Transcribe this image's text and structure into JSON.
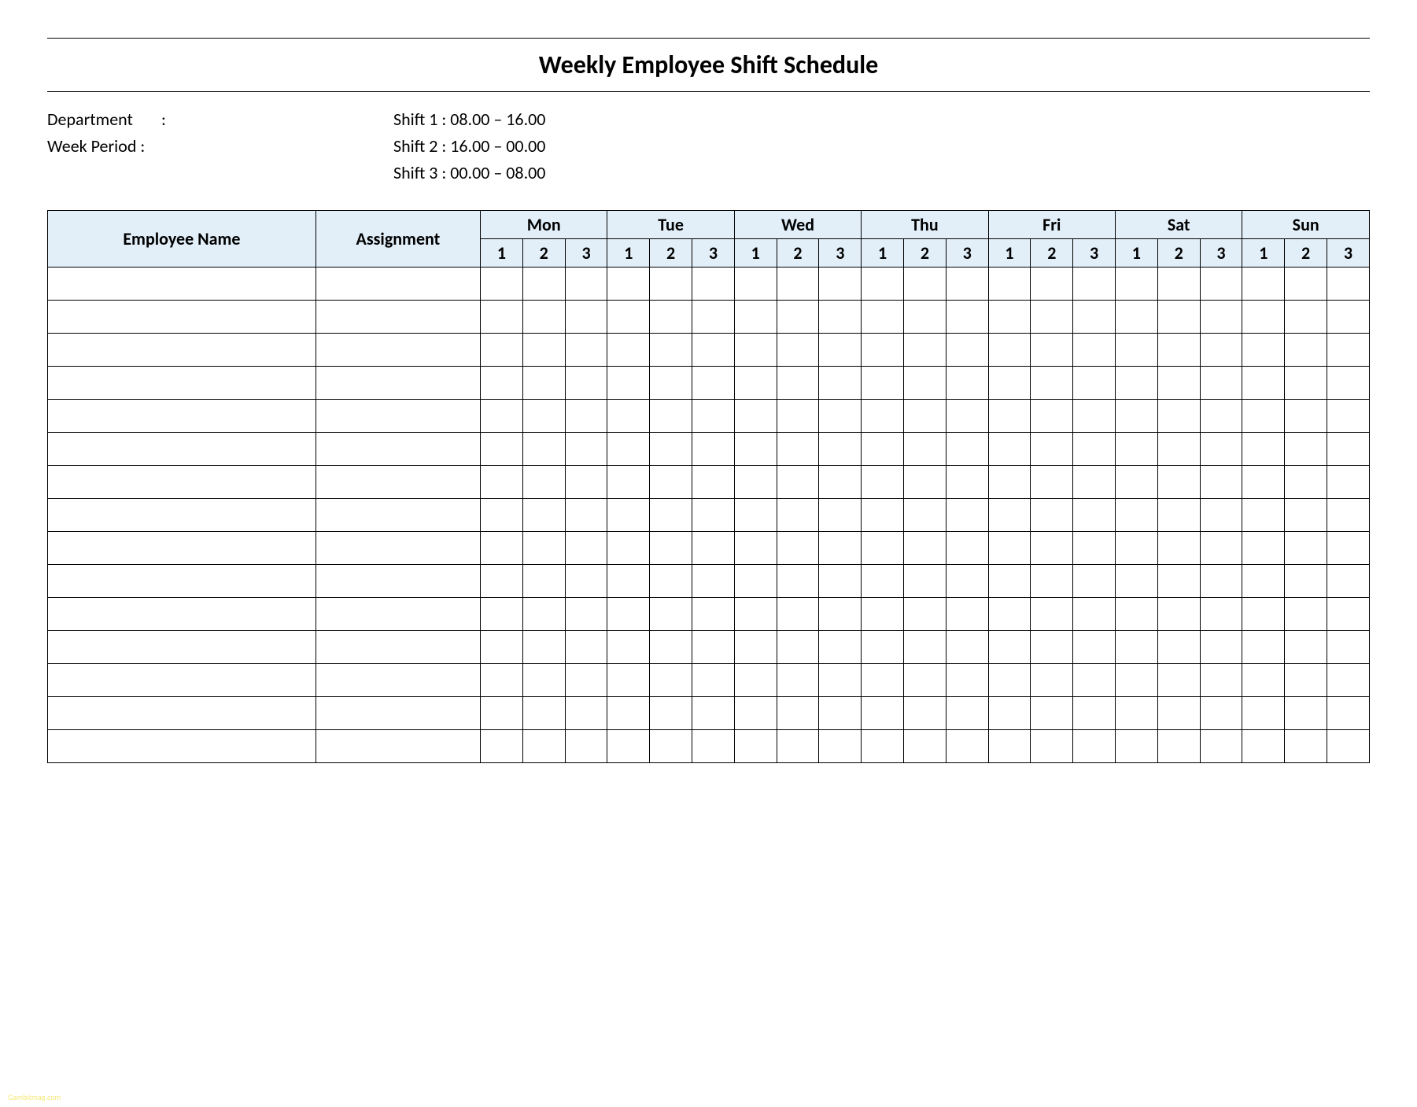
{
  "title": "Weekly Employee Shift Schedule",
  "meta": {
    "department_label": "Department",
    "department_sep": ":",
    "week_period_label": "Week  Period :",
    "shifts": [
      "Shift 1  : 08.00  – 16.00",
      "Shift 2  : 16.00  – 00.00",
      "Shift 3  : 00.00  – 08.00"
    ]
  },
  "table": {
    "employee_name_header": "Employee Name",
    "assignment_header": "Assignment",
    "days": [
      "Mon",
      "Tue",
      "Wed",
      "Thu",
      "Fri",
      "Sat",
      "Sun"
    ],
    "shift_numbers": [
      "1",
      "2",
      "3"
    ],
    "row_count": 15
  },
  "watermark": "Gambitmag.com"
}
